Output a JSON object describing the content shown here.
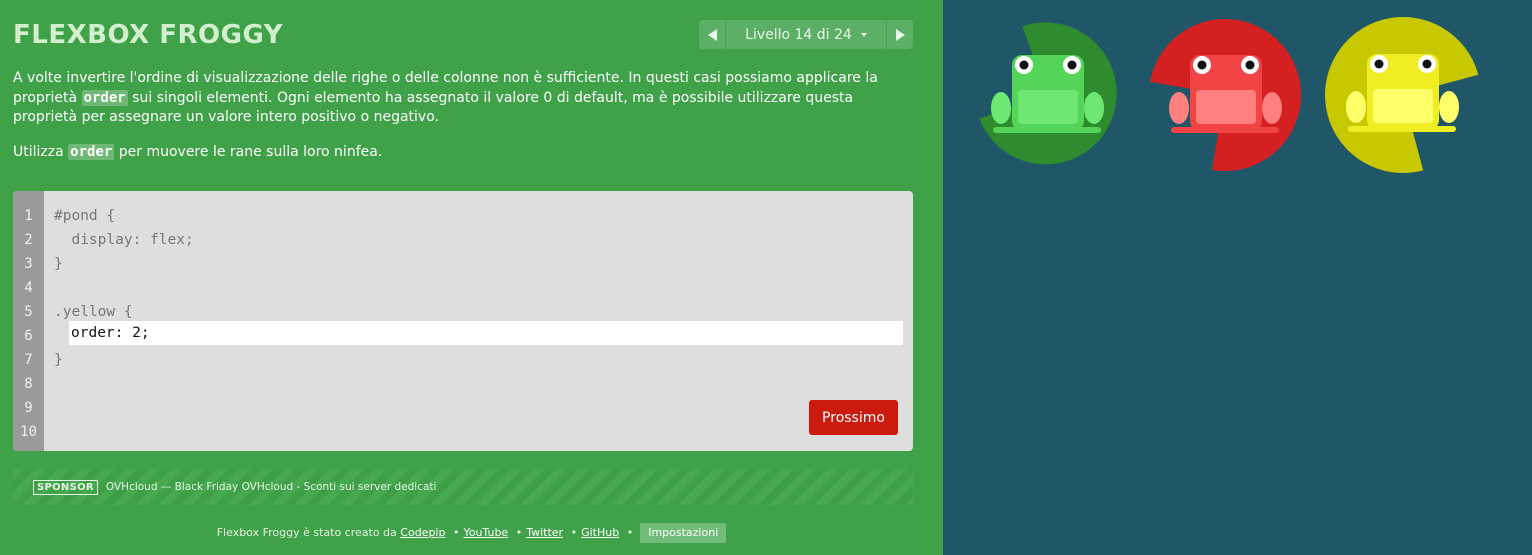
{
  "app": {
    "title": "FLEXBOX FROGGY"
  },
  "level_nav": {
    "label": "Livello 14 di 24"
  },
  "instructions": {
    "p1_before": "A volte invertire l'ordine di visualizzazione delle righe o delle colonne non è sufficiente. In questi casi possiamo applicare la proprietà",
    "p1_code": "order",
    "p1_after": "sui singoli elementi. Ogni elemento ha assegnato il valore 0 di default, ma è possibile utilizzare questa proprietà per assegnare un valore intero positivo o negativo.",
    "p2_before": "Utilizza",
    "p2_code": "order",
    "p2_after": "per muovere le rane sulla loro ninfea."
  },
  "editor": {
    "line_numbers": [
      "1",
      "2",
      "3",
      "4",
      "5",
      "6",
      "7",
      "8",
      "9",
      "10"
    ],
    "lines": [
      "#pond {",
      "  display: flex;",
      "}",
      "",
      ".yellow {",
      "",
      "}"
    ],
    "input_value": "order: 2;",
    "next_label": "Prossimo"
  },
  "sponsor": {
    "tag": "SPONSOR",
    "text": "OVHcloud — Black Friday OVHcloud - Sconti sui server dedicati"
  },
  "footer": {
    "prefix": "Flexbox Froggy è stato creato da",
    "links": [
      "Codepip",
      "YouTube",
      "Twitter",
      "GitHub"
    ],
    "separator": "•",
    "settings_label": "Impostazioni"
  },
  "pond": {
    "lilypads": [
      {
        "color": "green",
        "pad": "#2e8b2e"
      },
      {
        "color": "red",
        "pad": "#d42020"
      },
      {
        "color": "yellow",
        "pad": "#c8c800"
      }
    ],
    "frogs": [
      {
        "color": "green",
        "fill": "#55d45a",
        "light": "#6ee873"
      },
      {
        "color": "red",
        "fill": "#f24444",
        "light": "#ff7e7e"
      },
      {
        "color": "yellow",
        "fill": "#eeee22",
        "light": "#ffff6a"
      }
    ]
  },
  "colors": {
    "sidebar": "#3fa148",
    "pond_bg": "#1f5768",
    "next_button": "#cd1a0f"
  }
}
